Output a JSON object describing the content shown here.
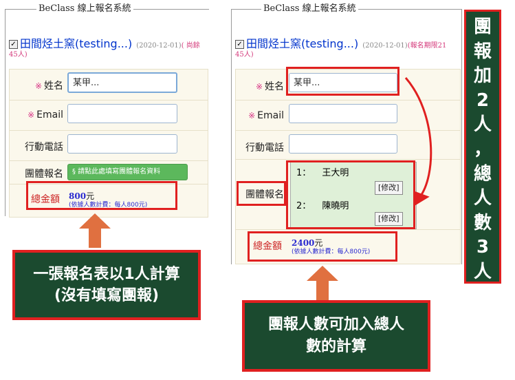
{
  "system_title": "BeClass 線上報名系統",
  "event": {
    "title": "田間烃土窯(testing...)",
    "date": "(2020-12-01)",
    "quota_left": "( 尚餘",
    "quota_left_2": "45人)",
    "quota_right": "(報名期限21",
    "quota_right_2": "45人)"
  },
  "form_left": {
    "name_label": "姓名",
    "name_value": "某甲...",
    "email_label": "Email",
    "phone_label": "行動電話",
    "group_label": "團體報名",
    "group_button": "§ 請點此處填寫團體報名資料",
    "total_label": "總金額",
    "total_amount": "800",
    "total_unit": "元",
    "total_note": "(依據人數計費：每人800元)"
  },
  "form_right": {
    "name_label": "姓名",
    "name_value": "某甲...",
    "email_label": "Email",
    "phone_label": "行動電話",
    "group_label": "團體報名",
    "members": [
      {
        "index": "1：",
        "name": "王大明",
        "edit": "[修改]"
      },
      {
        "index": "2：",
        "name": "陳曉明",
        "edit": "[修改]"
      }
    ],
    "total_label": "總金額",
    "total_amount": "2400",
    "total_unit": "元",
    "total_note": "(依據人數計費：每人800元)"
  },
  "required_mark": "※",
  "callout_left": {
    "line1": "一張報名表以1人計算",
    "line2": "(沒有填寫團報)"
  },
  "callout_right": {
    "line1": "團報人數可加入總人",
    "line2": "數的計算"
  },
  "callout_vertical": [
    "團",
    "報",
    "加",
    "2",
    "人",
    "，",
    "總",
    "人",
    "數",
    "3",
    "人"
  ],
  "colors": {
    "highlight_red": "#e02020",
    "callout_green": "#1b4a2f",
    "arrow_orange": "#e07040",
    "group_button_green": "#5cb85c"
  }
}
